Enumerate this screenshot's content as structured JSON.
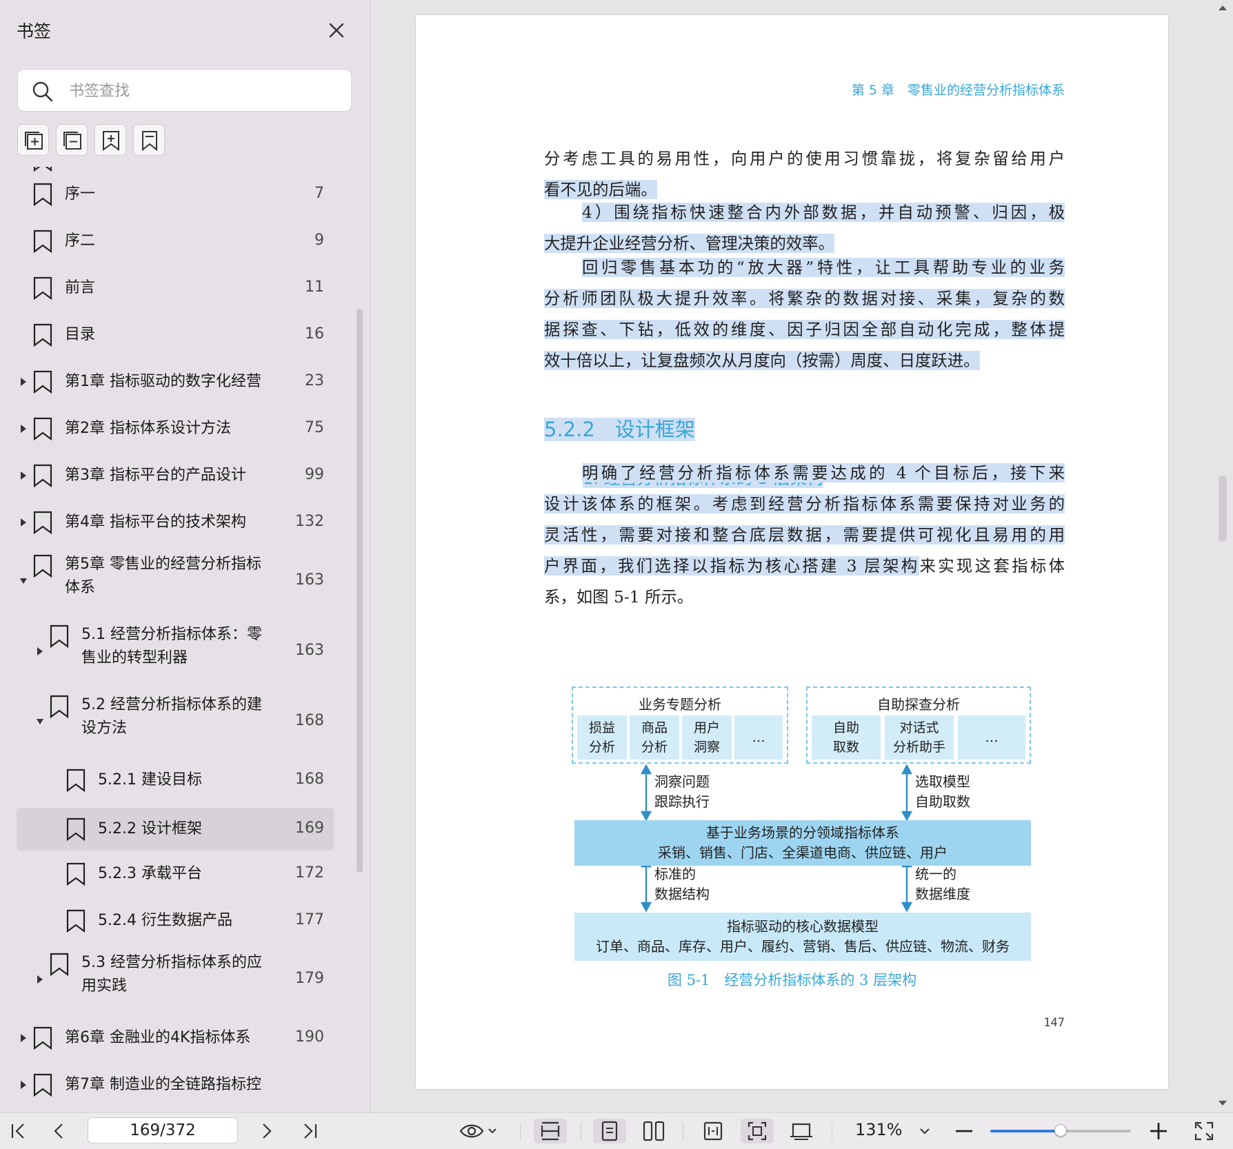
{
  "sidebar": {
    "title": "书签",
    "search_placeholder": "书签查找",
    "items": [
      {
        "label": "",
        "page": "",
        "partial": true
      },
      {
        "label": "序一",
        "page": "7"
      },
      {
        "label": "序二",
        "page": "9"
      },
      {
        "label": "前言",
        "page": "11"
      },
      {
        "label": "目录",
        "page": "16"
      },
      {
        "label": "第1章 指标驱动的数字化经营",
        "page": "23",
        "arrow": "collapsed"
      },
      {
        "label": "第2章 指标体系设计方法",
        "page": "75",
        "arrow": "collapsed"
      },
      {
        "label": "第3章 指标平台的产品设计",
        "page": "99",
        "arrow": "collapsed"
      },
      {
        "label": "第4章 指标平台的技术架构",
        "page": "132",
        "arrow": "collapsed"
      },
      {
        "label_lines": [
          "第5章 零售业的经营分析指标",
          "体系"
        ],
        "page": "163",
        "arrow": "expanded"
      },
      {
        "label_lines": [
          "5.1 经营分析指标体系：零",
          "售业的转型利器"
        ],
        "page": "163",
        "arrow": "collapsed"
      },
      {
        "label_lines": [
          "5.2 经营分析指标体系的建",
          "设方法"
        ],
        "page": "168",
        "arrow": "expanded"
      },
      {
        "label": "5.2.1 建设目标",
        "page": "168"
      },
      {
        "label": "5.2.2 设计框架",
        "page": "169",
        "selected": true
      },
      {
        "label": "5.2.3 承载平台",
        "page": "172"
      },
      {
        "label": "5.2.4 衍生数据产品",
        "page": "177"
      },
      {
        "label_lines": [
          "5.3 经营分析指标体系的应",
          "用实践"
        ],
        "page": "179",
        "arrow": "collapsed"
      },
      {
        "label": "第6章 金融业的4K指标体系",
        "page": "190",
        "arrow": "collapsed"
      },
      {
        "label": "第7章 制造业的全链路指标控",
        "page": "",
        "arrow": "collapsed",
        "partial": true
      }
    ]
  },
  "document": {
    "header": "第 5 章　零售业的经营分析指标体系",
    "p1_line1": "分考虑工具的易用性，向用户的使用习惯靠拢，将复杂留给用户",
    "p1_line2": "看不见的后端。",
    "p2_line1": "4）围绕指标快速整合内外部数据，并自动预警、归因，极",
    "p2_line2": "大提升企业经营分析、管理决策的效率。",
    "p3_line1": "回归零售基本功的“放大器”特性，让工具帮助专业的业务",
    "p3_line2": "分析师团队极大提升效率。将繁杂的数据对接、采集，复杂的数",
    "p3_line3": "据探查、下钻，低效的维度、因子归因全部自动化完成，整体提",
    "p3_line4": "效十倍以上，让复盘频次从月度向（按需）周度、日度跃进。",
    "section_heading": "5.2.2　设计框架",
    "subsection_heading": "1. 经营分析指标体系的 3 层架构",
    "p4_line1": "明确了经营分析指标体系需要达成的 4 个目标后，接下来",
    "p4_line2": "设计该体系的框架。考虑到经营分析指标体系需要保持对业务的",
    "p4_line3": "灵活性，需要对接和整合底层数据，需要提供可视化且易用的用",
    "p4_line4_hl": "户界面，我们选择以指标为核心搭建 3 层架构",
    "p4_line4_rest": "来实现这套指标体",
    "p4_line5": "系，如图 5-1 所示。",
    "page_number": "147"
  },
  "diagram": {
    "left_group_title": "业务专题分析",
    "left_cells": [
      "损益\n分析",
      "商品\n分析",
      "用户\n洞察",
      "…"
    ],
    "right_group_title": "自助探查分析",
    "right_cells": [
      "自助\n取数",
      "对话式\n分析助手",
      "…"
    ],
    "arrow1_left": [
      "洞察问题",
      "跟踪执行"
    ],
    "arrow1_right": [
      "选取模型",
      "自助取数"
    ],
    "band1": [
      "基于业务场景的分领域指标体系",
      "采销、销售、门店、全渠道电商、供应链、用户"
    ],
    "arrow2_left": [
      "标准的",
      "数据结构"
    ],
    "arrow2_right": [
      "统一的",
      "数据维度"
    ],
    "band2": [
      "指标驱动的核心数据模型",
      "订单、商品、库存、用户、履约、营销、售后、供应链、物流、财务"
    ],
    "caption": "图 5-1　经营分析指标体系的 3 层架构",
    "colors": {
      "dashed": "#7cc6ea",
      "cell": "#d2ecf8",
      "band1": "#9dd5f1",
      "band2": "#c9e9f8",
      "arrow": "#2f8fc8"
    }
  },
  "toolbar": {
    "page_indicator": "169/372",
    "zoom": "131%",
    "zoom_fraction": 0.5
  },
  "colors": {
    "accent": "#3aa6d6",
    "highlight": "#cfe0f5",
    "selected_row": "#d7d2d8",
    "slider": "#2f7be0"
  }
}
